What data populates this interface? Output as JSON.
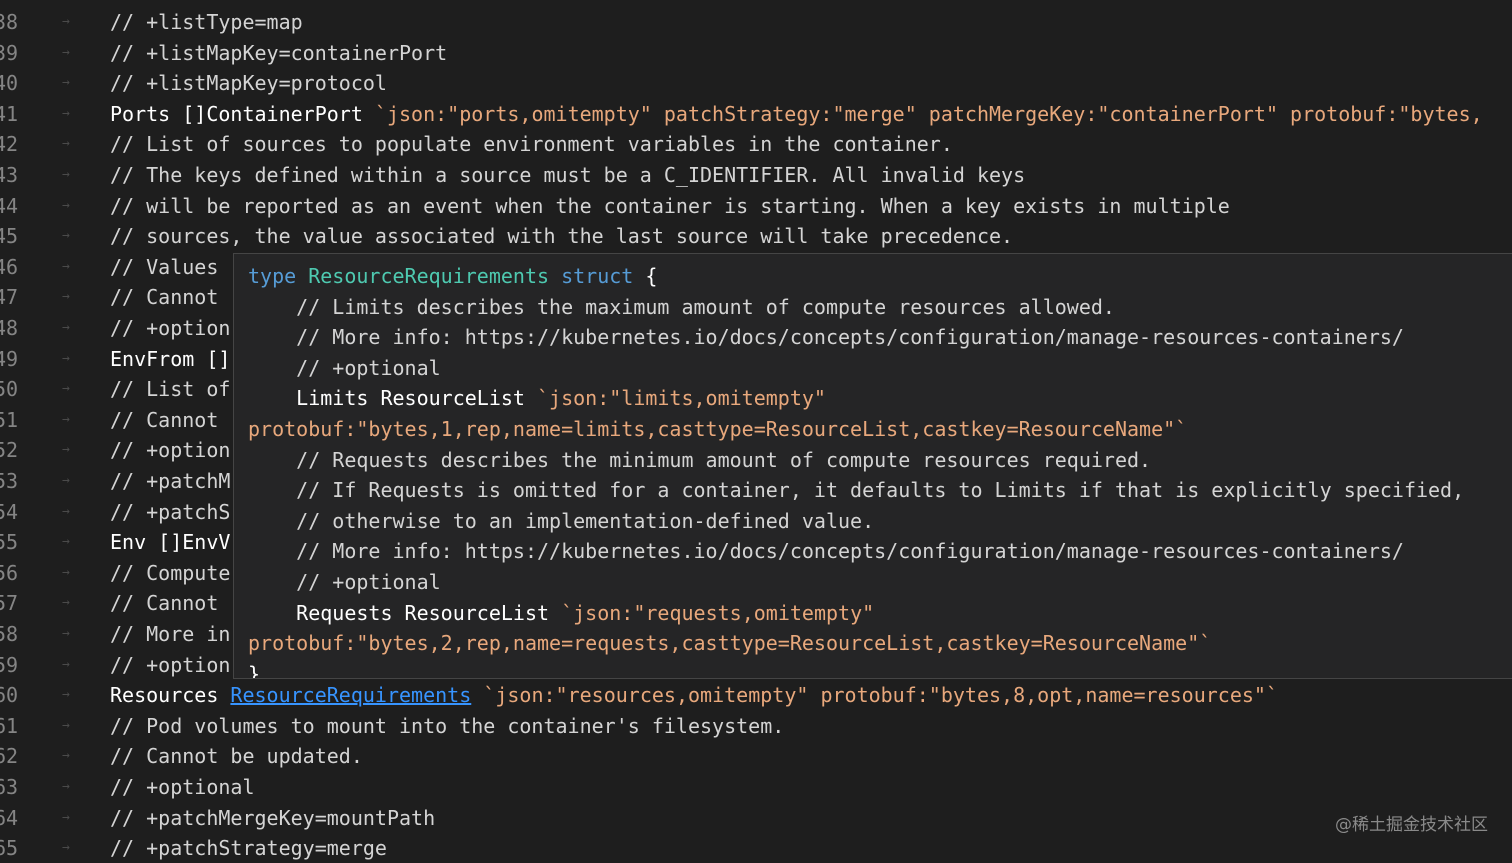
{
  "editor": {
    "lines": [
      {
        "num": "38",
        "parts": [
          {
            "t": "// +listType=map",
            "c": "c-comment"
          }
        ]
      },
      {
        "num": "39",
        "parts": [
          {
            "t": "// +listMapKey=containerPort",
            "c": "c-comment"
          }
        ]
      },
      {
        "num": "40",
        "parts": [
          {
            "t": "// +listMapKey=protocol",
            "c": "c-comment"
          }
        ]
      },
      {
        "num": "41",
        "parts": [
          {
            "t": "Ports []ContainerPort ",
            "c": "c-ident"
          },
          {
            "t": "`json:\"ports,omitempty\" patchStrategy:\"merge\" patchMergeKey:\"containerPort\" protobuf:\"bytes,",
            "c": "c-str"
          }
        ]
      },
      {
        "num": "42",
        "parts": [
          {
            "t": "// List of sources to populate environment variables in the container.",
            "c": "c-comment"
          }
        ]
      },
      {
        "num": "43",
        "parts": [
          {
            "t": "// The keys defined within a source must be a C_IDENTIFIER. All invalid keys",
            "c": "c-comment"
          }
        ]
      },
      {
        "num": "44",
        "parts": [
          {
            "t": "// will be reported as an event when the container is starting. When a key exists in multiple",
            "c": "c-comment"
          }
        ]
      },
      {
        "num": "45",
        "parts": [
          {
            "t": "// sources, the value associated with the last source will take precedence.",
            "c": "c-comment"
          }
        ]
      },
      {
        "num": "46",
        "parts": [
          {
            "t": "// Values",
            "c": "c-comment"
          }
        ]
      },
      {
        "num": "47",
        "parts": [
          {
            "t": "// Cannot",
            "c": "c-comment"
          }
        ]
      },
      {
        "num": "48",
        "parts": [
          {
            "t": "// +option",
            "c": "c-comment"
          }
        ]
      },
      {
        "num": "49",
        "parts": [
          {
            "t": "EnvFrom []",
            "c": "c-ident"
          }
        ]
      },
      {
        "num": "50",
        "parts": [
          {
            "t": "// List of",
            "c": "c-comment"
          }
        ]
      },
      {
        "num": "51",
        "parts": [
          {
            "t": "// Cannot",
            "c": "c-comment"
          }
        ]
      },
      {
        "num": "52",
        "parts": [
          {
            "t": "// +option",
            "c": "c-comment"
          }
        ]
      },
      {
        "num": "53",
        "parts": [
          {
            "t": "// +patchM",
            "c": "c-comment"
          }
        ]
      },
      {
        "num": "54",
        "parts": [
          {
            "t": "// +patchS",
            "c": "c-comment"
          }
        ]
      },
      {
        "num": "55",
        "parts": [
          {
            "t": "Env []EnvV",
            "c": "c-ident"
          }
        ]
      },
      {
        "num": "56",
        "parts": [
          {
            "t": "// Compute",
            "c": "c-comment"
          }
        ]
      },
      {
        "num": "57",
        "parts": [
          {
            "t": "// Cannot",
            "c": "c-comment"
          }
        ]
      },
      {
        "num": "58",
        "parts": [
          {
            "t": "// More in",
            "c": "c-comment"
          }
        ]
      },
      {
        "num": "59",
        "parts": [
          {
            "t": "// +option",
            "c": "c-comment"
          }
        ]
      },
      {
        "num": "60",
        "parts": [
          {
            "t": "Resources ",
            "c": "c-ident"
          },
          {
            "t": "ResourceRequirements",
            "c": "c-link"
          },
          {
            "t": " `json:\"resources,omitempty\" protobuf:\"bytes,8,opt,name=resources\"`",
            "c": "c-str"
          }
        ]
      },
      {
        "num": "61",
        "parts": [
          {
            "t": "// Pod volumes to mount into the container's filesystem.",
            "c": "c-comment"
          }
        ]
      },
      {
        "num": "62",
        "parts": [
          {
            "t": "// Cannot be updated.",
            "c": "c-comment"
          }
        ]
      },
      {
        "num": "63",
        "parts": [
          {
            "t": "// +optional",
            "c": "c-comment"
          }
        ]
      },
      {
        "num": "64",
        "parts": [
          {
            "t": "// +patchMergeKey=mountPath",
            "c": "c-comment"
          }
        ]
      },
      {
        "num": "65",
        "parts": [
          {
            "t": "// +patchStrategy=merge",
            "c": "c-comment"
          }
        ]
      }
    ]
  },
  "hover": {
    "lines": [
      [
        {
          "t": "type ",
          "c": "c-kw"
        },
        {
          "t": "ResourceRequirements",
          "c": "c-tname"
        },
        {
          "t": " struct",
          "c": "c-kw"
        },
        {
          "t": " {",
          "c": "c-ident"
        }
      ],
      [
        {
          "t": "    // Limits describes the maximum amount of compute resources allowed.",
          "c": "c-comment"
        }
      ],
      [
        {
          "t": "    // More info: https://kubernetes.io/docs/concepts/configuration/manage-resources-containers/",
          "c": "c-comment"
        }
      ],
      [
        {
          "t": "    // +optional",
          "c": "c-comment"
        }
      ],
      [
        {
          "t": "    Limits ResourceList ",
          "c": "c-ident"
        },
        {
          "t": "`json:\"limits,omitempty\"",
          "c": "c-str"
        }
      ],
      [
        {
          "t": "protobuf:\"bytes,1,rep,name=limits,casttype=ResourceList,castkey=ResourceName\"`",
          "c": "c-str"
        }
      ],
      [
        {
          "t": "    // Requests describes the minimum amount of compute resources required.",
          "c": "c-comment"
        }
      ],
      [
        {
          "t": "    // If Requests is omitted for a container, it defaults to Limits if that is explicitly specified,",
          "c": "c-comment"
        }
      ],
      [
        {
          "t": "    // otherwise to an implementation-defined value.",
          "c": "c-comment"
        }
      ],
      [
        {
          "t": "    // More info: https://kubernetes.io/docs/concepts/configuration/manage-resources-containers/",
          "c": "c-comment"
        }
      ],
      [
        {
          "t": "    // +optional",
          "c": "c-comment"
        }
      ],
      [
        {
          "t": "    Requests ResourceList ",
          "c": "c-ident"
        },
        {
          "t": "`json:\"requests,omitempty\"",
          "c": "c-str"
        }
      ],
      [
        {
          "t": "protobuf:\"bytes,2,rep,name=requests,casttype=ResourceList,castkey=ResourceName\"`",
          "c": "c-str"
        }
      ],
      [
        {
          "t": "}",
          "c": "c-ident"
        }
      ]
    ]
  },
  "watermark": "@稀土掘金技术社区",
  "colors": {
    "background": "#1e1e1e",
    "hover_background": "#252526",
    "keyword": "#569cd6",
    "type_name": "#4ec9b0",
    "string": "#e8a87c",
    "link": "#3794ff"
  }
}
